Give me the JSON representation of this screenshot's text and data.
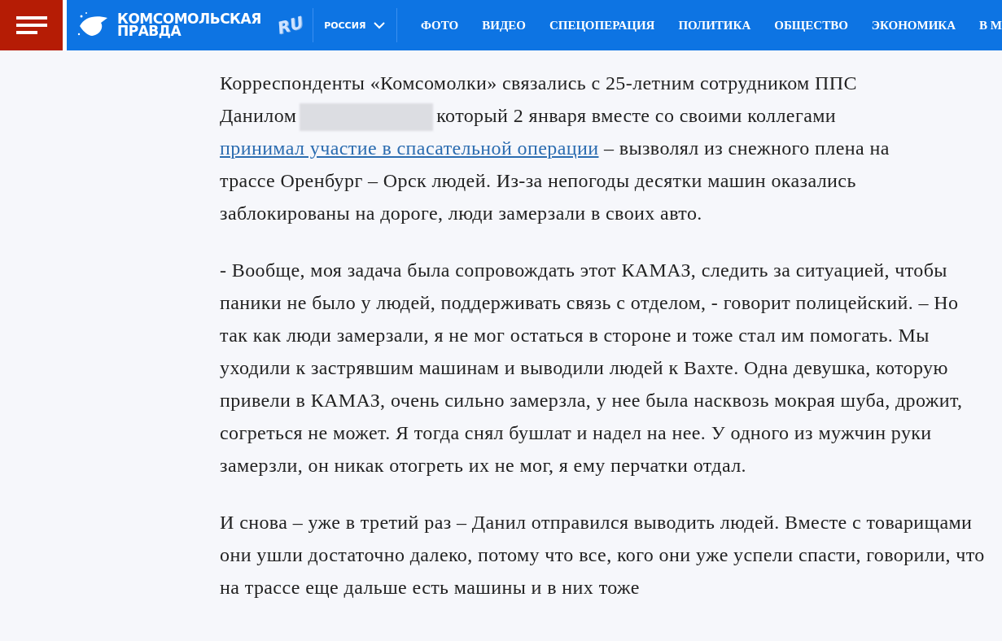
{
  "header": {
    "logo": {
      "line_1": "КОМСОМОЛЬСКАЯ",
      "line_2": "ПРАВДА",
      "badge": "RU"
    },
    "region": "РОССИЯ",
    "nav": [
      "ФОТО",
      "ВИДЕО",
      "СПЕЦОПЕРАЦИЯ",
      "ПОЛИТИКА",
      "ОБЩЕСТВО",
      "ЭКОНОМИКА",
      "В М"
    ]
  },
  "article": {
    "intro": {
      "before": "Корреспонденты «Комсомолки» связались с 25-летним сотрудником ППС",
      "name_start": "Данилом",
      "after": "который 2 января вместе со своими коллегами",
      "link": "принимал участие в спасательной операции",
      "link_tail": "– вызволял из снежного плена на",
      "rest": "трассе Оренбург – Орск людей. Из-за непогоды десятки машин оказались заблокированы на дороге, люди замерзали в своих авто."
    },
    "paragraphs": [
      "- Вообще, моя задача была сопровождать этот КАМАЗ, следить за ситуацией, чтобы паники не было у людей, поддерживать связь с отделом, - говорит полицейский. – Но так как люди замерзали, я не мог остаться в стороне и тоже стал им помогать. Мы уходили к застрявшим машинам и выводили людей к Вахте. Одна девушка, которую привели в КАМАЗ, очень сильно замерзла, у нее была насквозь мокрая шуба, дрожит, согреться не может. Я тогда снял бушлат и надел на нее. У одного из мужчин руки замерзли, он никак отогреть их не мог, я ему перчатки отдал.",
      "И снова – уже в третий раз – Данил отправился выводить людей. Вместе с товарищами они ушли достаточно далеко, потому что все, кого они уже успели спасти, говорили, что на трассе еще дальше есть машины и в них тоже"
    ]
  }
}
